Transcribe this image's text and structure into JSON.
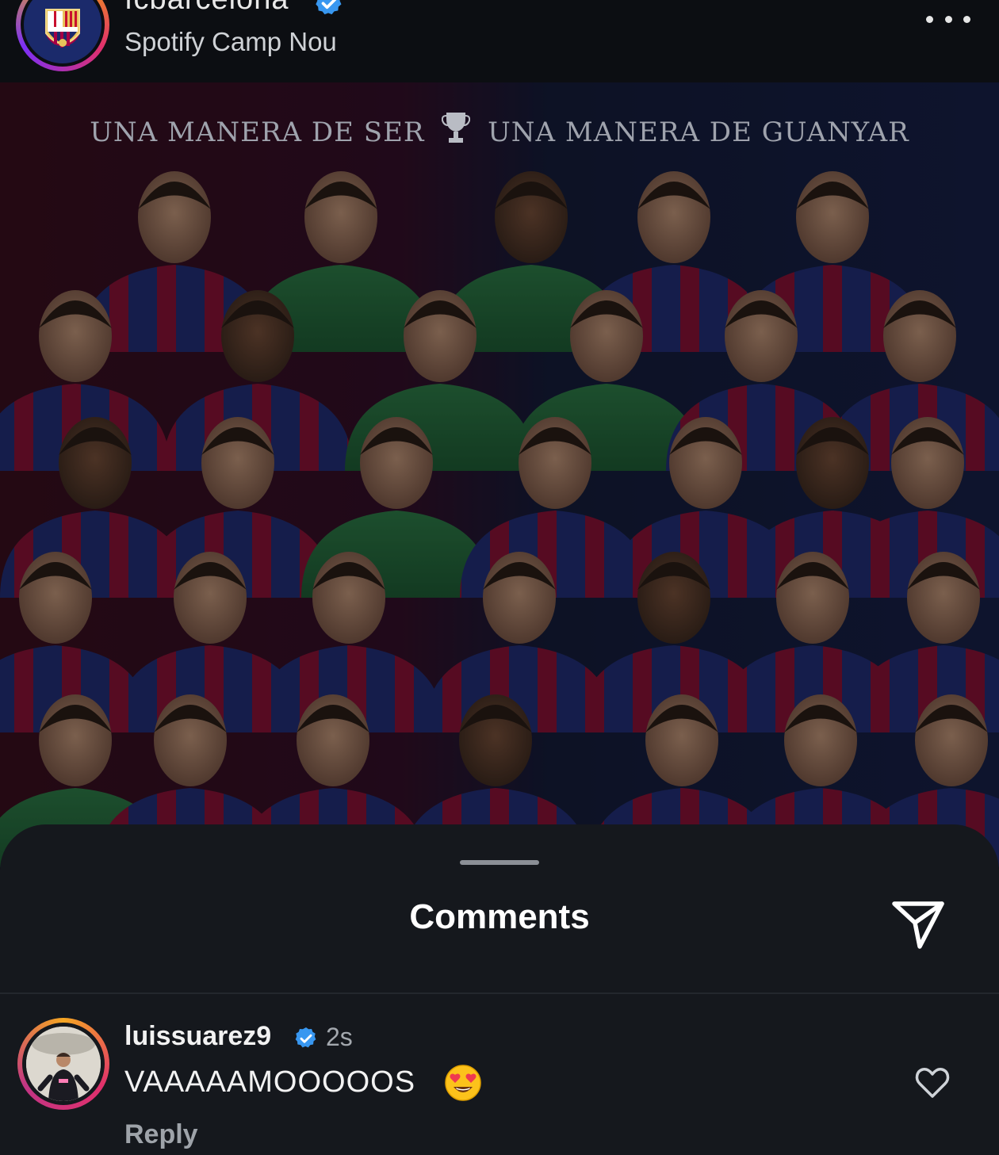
{
  "header": {
    "username": "fcbarcelona",
    "location": "Spotify Camp Nou",
    "more_icon": "more-horizontal-icon"
  },
  "post": {
    "headline_left": "UNA MANERA DE SER",
    "headline_icon": "trophy-icon",
    "headline_right": "UNA MANERA DE GUANYAR"
  },
  "comments_sheet": {
    "title": "Comments",
    "share_icon": "send-icon"
  },
  "comments": [
    {
      "username": "luissuarez9",
      "time": "2s",
      "text": "VAAAAAMOOOOOS",
      "emoji": "😍",
      "reply_label": "Reply",
      "like_icon": "heart-icon"
    }
  ],
  "colors": {
    "background": "#0b0d10",
    "sheet": "#15181d",
    "verified": "#3897f0",
    "barca_blue": "#1b2a6b",
    "barca_red": "#a50044"
  }
}
